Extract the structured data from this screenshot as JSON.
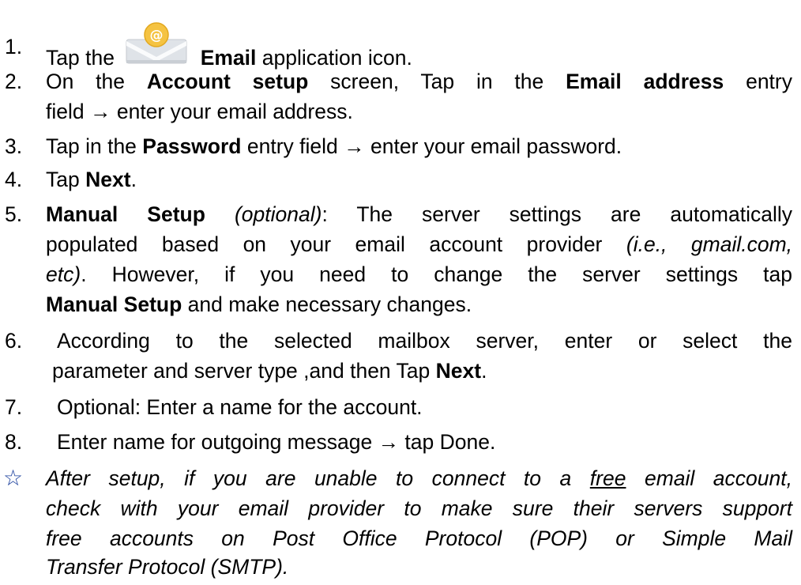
{
  "steps": [
    {
      "num": "1.",
      "before": "Tap the",
      "bold": "Email",
      "after": "application icon.",
      "icon": "email-app-icon"
    },
    {
      "num": "2.",
      "t1": "On the",
      "b1": "Account setup",
      "t2": "screen, Tap in the",
      "b2": "Email address",
      "t3": "entry",
      "line2": "field → enter your email address."
    },
    {
      "num": "3.",
      "t1": "Tap in the",
      "b1": "Password",
      "t2": "entry field → enter your email password."
    },
    {
      "num": "4.",
      "t1": "Tap",
      "b1": "Next",
      "t2": "."
    },
    {
      "num": "5.",
      "b1": "Manual Setup",
      "i1": "(optional)",
      "t1": ": The server settings are automatically",
      "l2a": "populated based on your email account provider",
      "l2i": "(i.e., gmail.com,",
      "l3i": "etc)",
      "l3a": ". However, if you need to change the server settings tap",
      "l4b": "Manual Setup",
      "l4a": "and make necessary changes."
    },
    {
      "num": "6.",
      "t1": "According to the selected mailbox server, enter or select the",
      "l2a": "parameter and server type ,and then Tap",
      "l2b": "Next",
      "l2c": "."
    },
    {
      "num": "7.",
      "t1": "Optional: Enter a name for the account."
    },
    {
      "num": "8.",
      "t1": "Enter name for outgoing message → tap Done."
    }
  ],
  "note": {
    "symbol": "☆",
    "l1a": "After setup, if you are unable to connect to a",
    "l1u": "free",
    "l1b": "email account,",
    "l2": "check with your email provider to make sure their servers support",
    "l3": "free accounts on Post Office Protocol (POP) or Simple Mail",
    "l4": "Transfer Protocol (SMTP)."
  },
  "colors": {
    "note_star": "#1a3f9c",
    "icon_envelope": "#d9dde2",
    "icon_badge": "#f5c342"
  }
}
